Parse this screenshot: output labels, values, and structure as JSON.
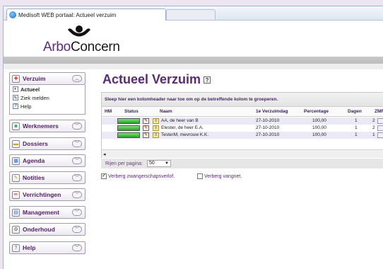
{
  "browser": {
    "tab_title": "Medisoft WEB portaal: Actueel verzuim",
    "favicon": "ie-icon"
  },
  "logo": {
    "text_pre": "Arbo",
    "text_post": "Concern",
    "mark": "person-arc-mark"
  },
  "sidebar": {
    "verzuim": {
      "label": "Verzuim",
      "expanded": true,
      "items": [
        {
          "label": "Actueel",
          "active": true
        },
        {
          "label": "Ziek melden",
          "active": false
        },
        {
          "label": "Help",
          "active": false
        }
      ]
    },
    "sections": [
      {
        "label": "Werknemers",
        "icon": "people-icon"
      },
      {
        "label": "Dossiers",
        "icon": "folder-icon"
      },
      {
        "label": "Agenda",
        "icon": "calendar-icon"
      },
      {
        "label": "Notities",
        "icon": "note-icon"
      },
      {
        "label": "Verrichtingen",
        "icon": "pencil-icon"
      },
      {
        "label": "Management",
        "icon": "chart-icon"
      },
      {
        "label": "Onderhoud",
        "icon": "wrench-icon"
      },
      {
        "label": "Help",
        "icon": "help-icon"
      }
    ]
  },
  "main": {
    "title": "Actueel Verzuim",
    "help_icon_label": "?",
    "group_hint": "Sleep hier een kolomheader naar toe om op de betreffende kolom te groeperen.",
    "columns": [
      "HM",
      "Status",
      "Naam",
      "1e Verzuimdag",
      "Percentage",
      "Dagen",
      "ZMF"
    ],
    "rows": [
      {
        "naam": "AA, de heer van B",
        "datum": "27-10-2010",
        "percentage": "100,00",
        "dagen": "1",
        "zmf": "2"
      },
      {
        "naam": "Etester, de heer E.A.",
        "datum": "27-10-2010",
        "percentage": "100,00",
        "dagen": "1",
        "zmf": "2"
      },
      {
        "naam": "TesterM, mevrouw K.K.",
        "datum": "27-10-2010",
        "percentage": "100,00",
        "dagen": "1",
        "zmf": "1"
      }
    ],
    "pager": {
      "label": "Rijen per pagina:",
      "value": "50"
    },
    "checkboxes": [
      {
        "label": "Verberg zwangerschapsverlof.",
        "checked": true
      },
      {
        "label": "Verberg vangnet.",
        "checked": false
      }
    ]
  },
  "colors": {
    "brand_purple": "#5b2a74",
    "row_alt": "#eae9f5",
    "status_green": "#22a51f"
  }
}
